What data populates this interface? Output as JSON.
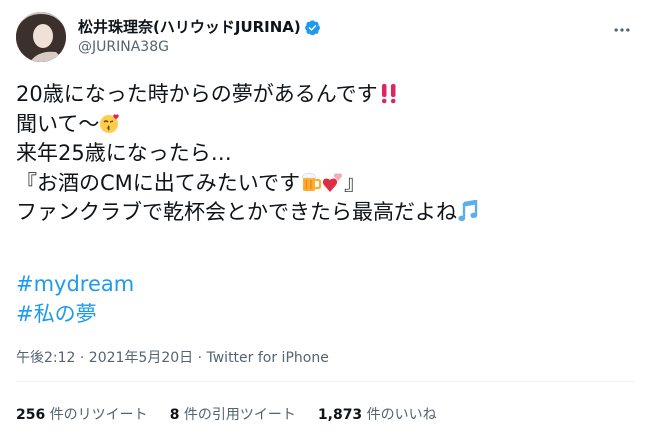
{
  "header": {
    "display_name": "松井珠理奈(ハリウッドJURINA)",
    "handle": "@JURINA38G"
  },
  "tweet": {
    "lines": [
      "20歳になった時からの夢があるんです",
      "聞いて〜",
      "来年25歳になったら…",
      "『お酒のCMに出てみたいです",
      "』",
      "ファンクラブで乾杯会とかできたら最高だよね"
    ],
    "hashtags": [
      "#mydream",
      "#私の夢"
    ]
  },
  "meta": {
    "timestamp": "午後2:12 · 2021年5月20日 · Twitter for iPhone"
  },
  "stats": {
    "retweets_count": "256",
    "retweets_label": "件のリツイート",
    "quotes_count": "8",
    "quotes_label": "件の引用ツイート",
    "likes_count": "1,873",
    "likes_label": "件のいいね"
  },
  "icons": {
    "verified": "verified-badge-icon",
    "more": "more-dots-icon",
    "double_exclamation": "double-exclamation-icon",
    "kiss_face": "kissing-face-icon",
    "beer": "beer-mug-icon",
    "hearts": "two-hearts-icon",
    "music": "musical-notes-icon"
  },
  "colors": {
    "link": "#1d9bf0",
    "secondary_text": "#536471",
    "verified": "#1d9bf0"
  }
}
